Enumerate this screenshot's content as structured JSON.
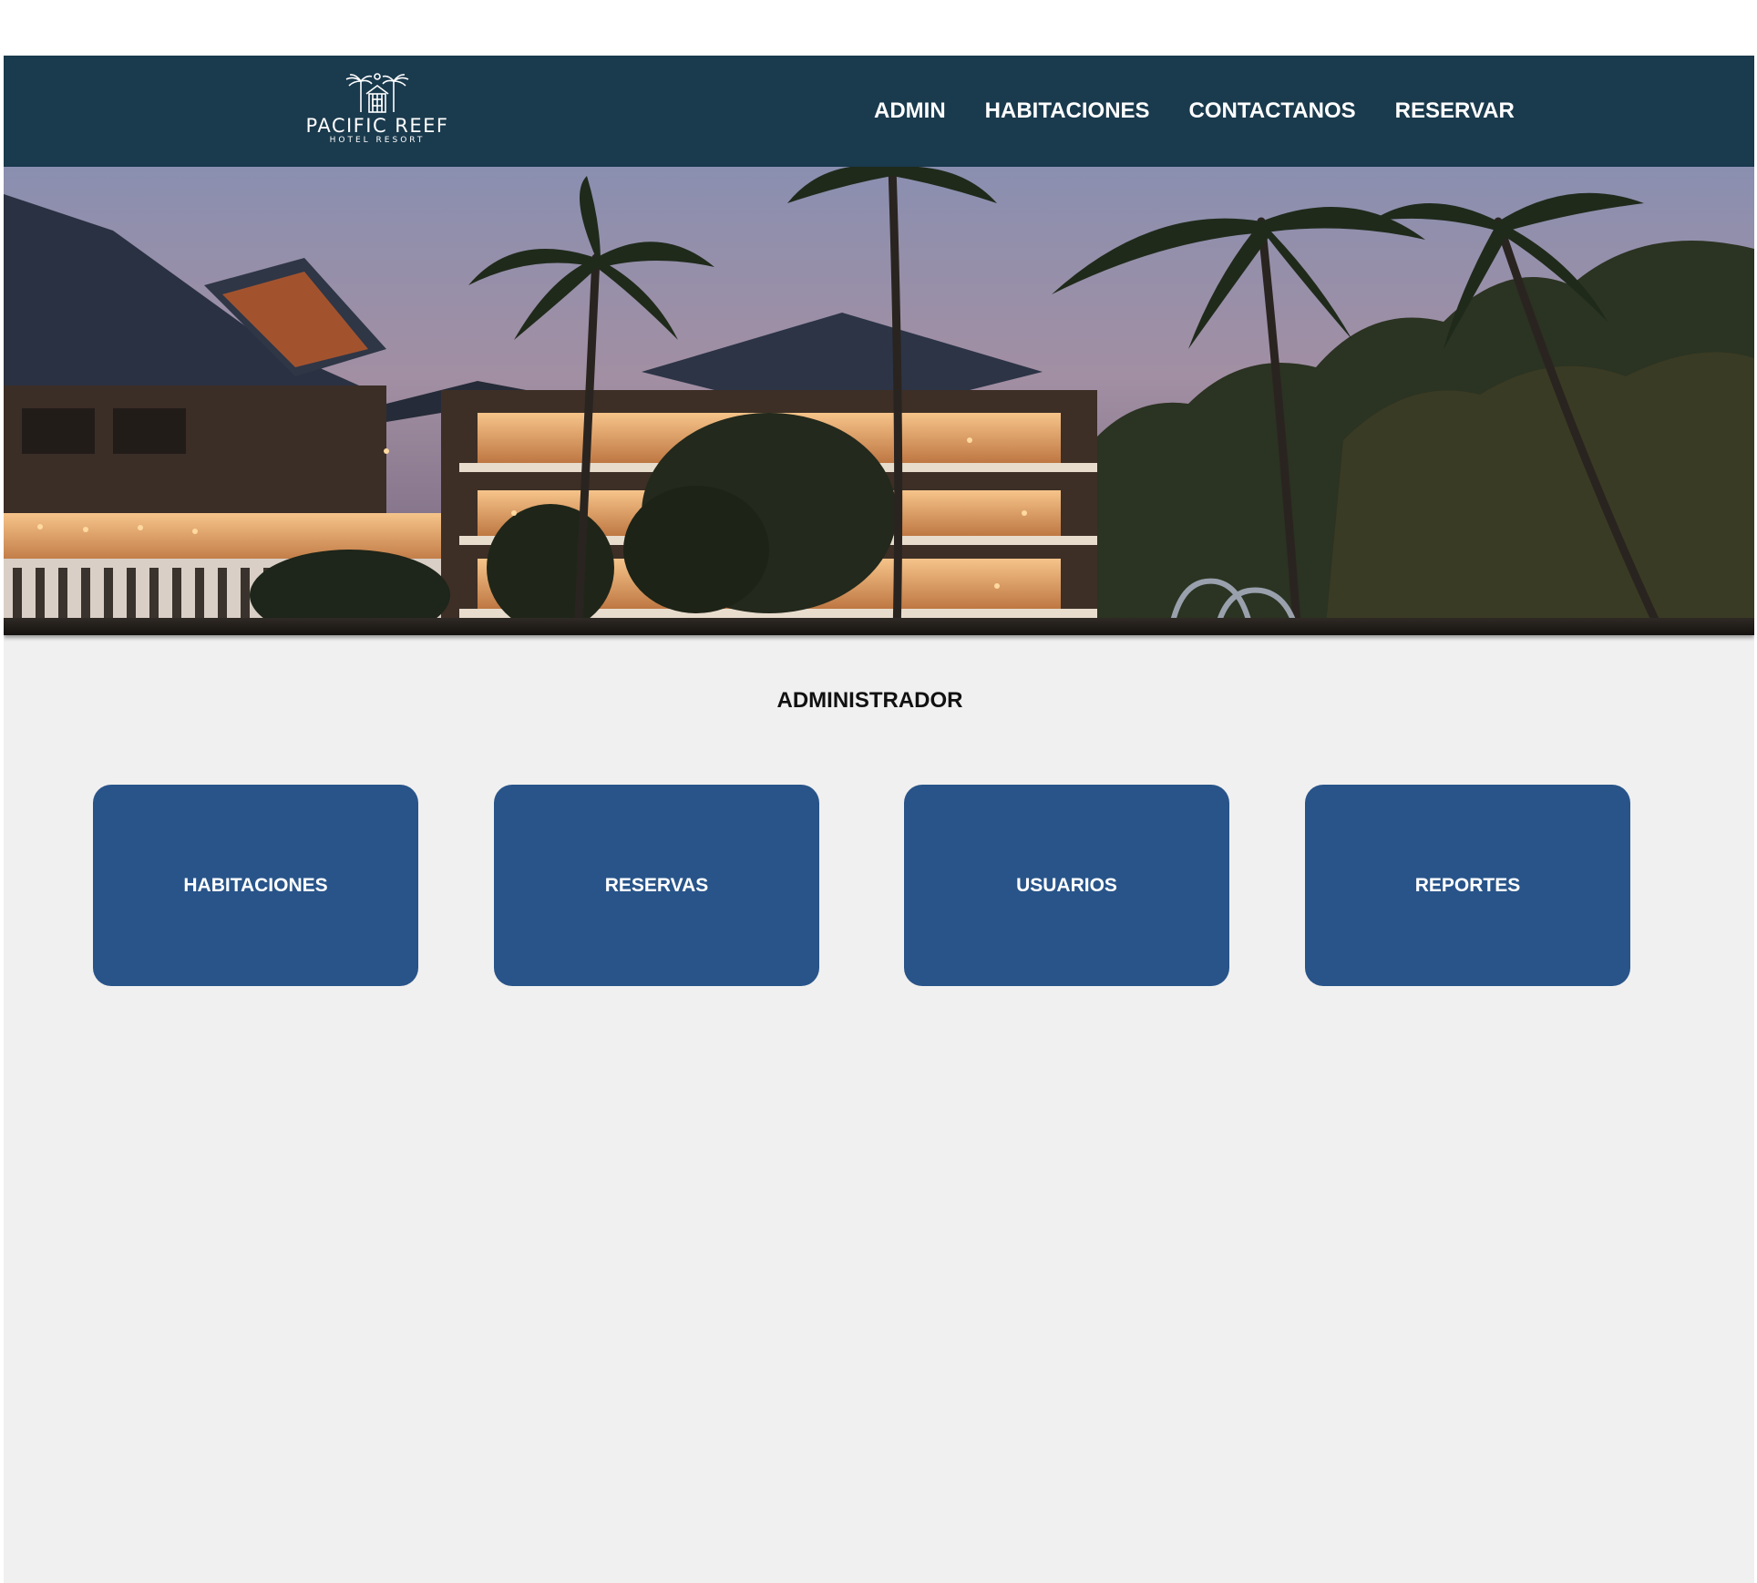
{
  "brand": {
    "name": "PACIFIC REEF",
    "tagline": "HOTEL RESORT",
    "logo_icon": "palm-hut-icon"
  },
  "nav": {
    "items": [
      {
        "label": "ADMIN"
      },
      {
        "label": "HABITACIONES"
      },
      {
        "label": "CONTACTANOS"
      },
      {
        "label": "RESERVAR"
      }
    ]
  },
  "hero": {
    "image_subject": "hotel-resort-at-dusk-with-palm-trees"
  },
  "main": {
    "title": "ADMINISTRADOR",
    "cards": [
      {
        "label": "HABITACIONES"
      },
      {
        "label": "RESERVAS"
      },
      {
        "label": "USUARIOS"
      },
      {
        "label": "REPORTES"
      }
    ]
  },
  "colors": {
    "header_bg": "#1a3a4d",
    "card_bg": "#285489",
    "page_bg": "#f0f0f0",
    "text_light": "#ffffff"
  }
}
